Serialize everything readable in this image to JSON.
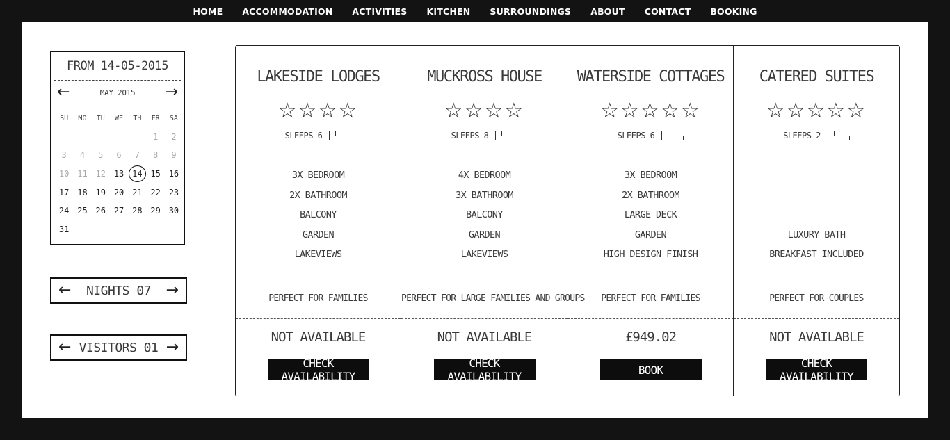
{
  "nav": [
    "HOME",
    "ACCOMMODATION",
    "ACTIVITIES",
    "KITCHEN",
    "SURROUNDINGS",
    "ABOUT",
    "CONTACT",
    "BOOKING"
  ],
  "calendar": {
    "from_label": "FROM 14-05-2015",
    "month_label": "MAY 2015",
    "weekdays": [
      "SU",
      "MO",
      "TU",
      "WE",
      "TH",
      "FR",
      "SA"
    ],
    "leading_blanks": 5,
    "days": [
      "1",
      "2",
      "3",
      "4",
      "5",
      "6",
      "7",
      "8",
      "9",
      "10",
      "11",
      "12",
      "13",
      "14",
      "15",
      "16",
      "17",
      "18",
      "19",
      "20",
      "21",
      "22",
      "23",
      "24",
      "25",
      "26",
      "27",
      "28",
      "29",
      "30",
      "31"
    ],
    "dim_until": 12,
    "selected_day": "14",
    "prev_icon": "arrow-left-icon",
    "next_icon": "arrow-right-icon"
  },
  "nights": {
    "label": "NIGHTS 07"
  },
  "visitors": {
    "label": "VISITORS 01"
  },
  "cards": [
    {
      "title": "LAKESIDE LODGES",
      "stars": 4,
      "sleeps": "SLEEPS 6",
      "features": [
        "3X BEDROOM",
        "2X BATHROOM",
        "BALCONY",
        "GARDEN",
        "LAKEVIEWS"
      ],
      "tagline": "PERFECT FOR FAMILIES",
      "status": "NOT AVAILABLE",
      "cta": "CHECK AVAILABILITY"
    },
    {
      "title": "MUCKROSS HOUSE",
      "stars": 4,
      "sleeps": "SLEEPS 8",
      "features": [
        "4X BEDROOM",
        "3X BATHROOM",
        "BALCONY",
        "GARDEN",
        "LAKEVIEWS"
      ],
      "tagline": "PERFECT FOR LARGE FAMILIES AND GROUPS",
      "status": "NOT AVAILABLE",
      "cta": "CHECK AVAILABILITY"
    },
    {
      "title": "WATERSIDE COTTAGES",
      "stars": 5,
      "sleeps": "SLEEPS 6",
      "features": [
        "3X BEDROOM",
        "2X BATHROOM",
        "LARGE DECK",
        "GARDEN",
        "HIGH DESIGN FINISH"
      ],
      "tagline": "PERFECT FOR FAMILIES",
      "status": "£949.02",
      "cta": "BOOK"
    },
    {
      "title": "CATERED SUITES",
      "stars": 5,
      "sleeps": "SLEEPS 2",
      "features": [
        "",
        "",
        "",
        "LUXURY BATH",
        "BREAKFAST INCLUDED"
      ],
      "tagline": "PERFECT FOR COUPLES",
      "status": "NOT AVAILABLE",
      "cta": "CHECK AVAILABILITY"
    }
  ]
}
